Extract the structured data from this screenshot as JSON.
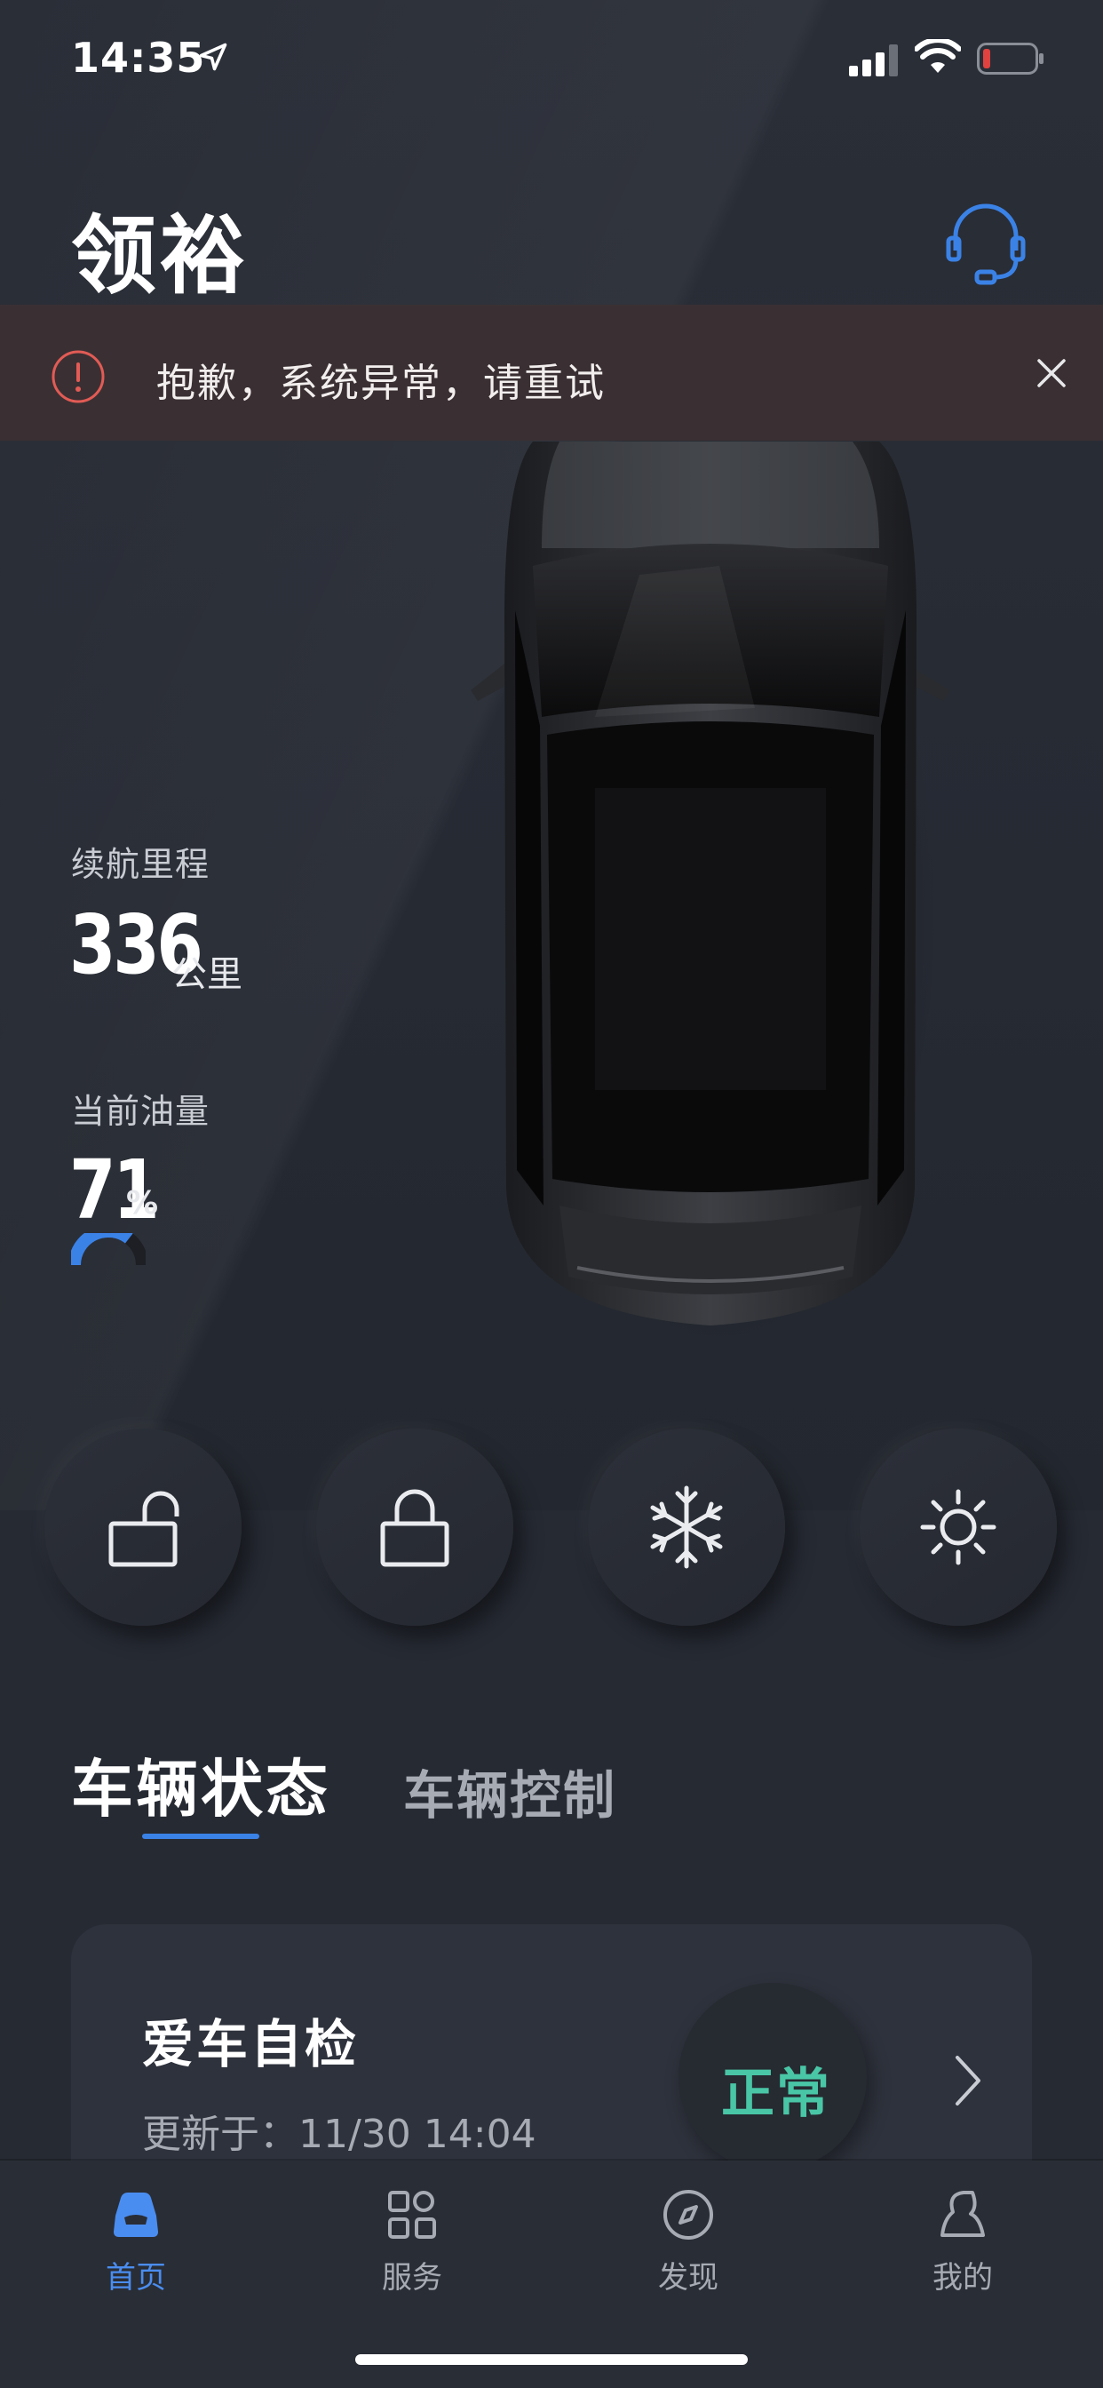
{
  "status_bar": {
    "time": "14:35",
    "location_icon": "location-arrow-icon",
    "signal_icon": "cellular-signal-icon",
    "wifi_icon": "wifi-icon",
    "battery_icon": "battery-low-icon",
    "battery_color": "#e0423f"
  },
  "header": {
    "title": "领裕",
    "support_icon": "headset-icon",
    "accent": "#3b82e6"
  },
  "alert": {
    "message": "抱歉，系统异常，请重试",
    "icon": "alert-circle-icon",
    "icon_color": "#e25b55",
    "close_icon": "close-icon"
  },
  "vehicle": {
    "range_label": "续航里程",
    "range_value": "336",
    "range_unit": "公里",
    "fuel_label": "当前油量",
    "fuel_value": "71",
    "fuel_unit": "%",
    "fuel_level": 0.71
  },
  "controls": [
    {
      "name": "unlock",
      "icon": "unlock-icon"
    },
    {
      "name": "lock",
      "icon": "lock-icon"
    },
    {
      "name": "ac",
      "icon": "snowflake-icon"
    },
    {
      "name": "heat",
      "icon": "sun-icon"
    }
  ],
  "tabs": [
    {
      "label": "车辆状态",
      "active": true
    },
    {
      "label": "车辆控制",
      "active": false
    }
  ],
  "status_card": {
    "title": "爱车自检",
    "updated": "更新于：11/30 14:04",
    "status": "正常",
    "status_color": "#49c6a6"
  },
  "bottom_nav": [
    {
      "label": "首页",
      "icon": "car-home-icon",
      "active": true
    },
    {
      "label": "服务",
      "icon": "grid-icon",
      "active": false
    },
    {
      "label": "发现",
      "icon": "compass-icon",
      "active": false
    },
    {
      "label": "我的",
      "icon": "user-icon",
      "active": false
    }
  ]
}
